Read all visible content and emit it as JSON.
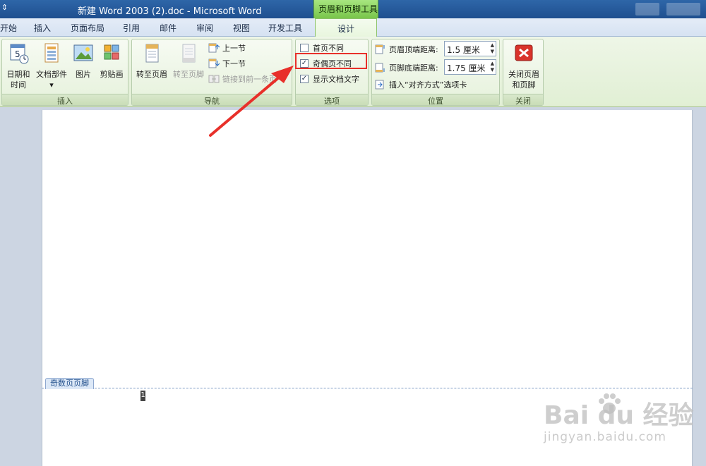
{
  "titlebar": {
    "qat_glyph": "⇕",
    "title": "新建 Word 2003 (2).doc - Microsoft Word",
    "context_tool": "页眉和页脚工具"
  },
  "tabs": [
    {
      "label": "开始"
    },
    {
      "label": "插入"
    },
    {
      "label": "页面布局"
    },
    {
      "label": "引用"
    },
    {
      "label": "邮件"
    },
    {
      "label": "审阅"
    },
    {
      "label": "视图"
    },
    {
      "label": "开发工具"
    },
    {
      "label": "设计",
      "active": true
    }
  ],
  "ribbon": {
    "insert": {
      "label": "插入",
      "date_time_line1": "日期和",
      "date_time_line2": "时间",
      "calendar_number": "5",
      "doc_parts": "文档部件",
      "doc_parts_arrow": "▾",
      "picture": "图片",
      "clipart": "剪贴画"
    },
    "navigation": {
      "label": "导航",
      "goto_header": "转至页眉",
      "goto_footer": "转至页脚",
      "prev_section": "上一节",
      "next_section": "下一节",
      "link_prev": "链接到前一条页"
    },
    "options": {
      "label": "选项",
      "first_page_diff": {
        "label": "首页不同",
        "checked": false
      },
      "odd_even_diff": {
        "label": "奇偶页不同",
        "checked": true
      },
      "show_doc_text": {
        "label": "显示文档文字",
        "checked": true
      },
      "check_glyph": "✓"
    },
    "position": {
      "label": "位置",
      "header_top_label": "页眉顶端距离:",
      "header_top_value": "1.5 厘米",
      "footer_bottom_label": "页脚底端距离:",
      "footer_bottom_value": "1.75 厘米",
      "insert_align_tab": "插入“对齐方式”选项卡",
      "spin_arrows": "▲\n▼"
    },
    "close": {
      "label": "关闭",
      "close_line1": "关闭页眉",
      "close_line2": "和页脚",
      "close_glyph": "✕"
    }
  },
  "document": {
    "footer_tag": "奇数页页脚",
    "page_number": "1"
  },
  "watermark": {
    "brand": "Bai  du 经验",
    "url": "jingyan.baidu.com"
  },
  "colors": {
    "annotation_red": "#e8302a",
    "context_green": "#79c54b",
    "titlebar_blue": "#1f4f8f"
  }
}
